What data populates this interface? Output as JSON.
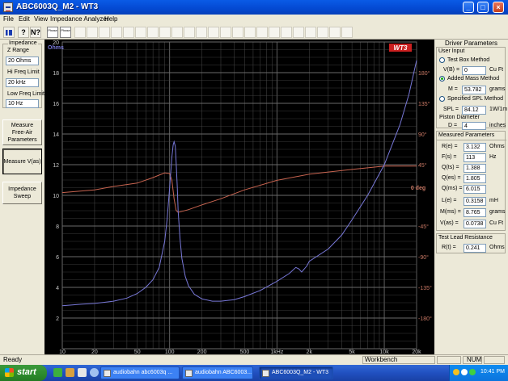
{
  "window": {
    "title": "ABC6003Q_M2 - WT3"
  },
  "titlebar_buttons": {
    "minimize": "_",
    "maximize": "□",
    "close": "×"
  },
  "menu": [
    "File",
    "Edit",
    "View",
    "Impedance Analyzer",
    "Help"
  ],
  "toolbar": {
    "tool1_icon": "chart-icon",
    "tool2_glyph": "?",
    "tool3_glyph": "N?",
    "tool4_label": "Phase",
    "tool5_label": "Phase"
  },
  "sidebar": {
    "impedance_label": "Impedance",
    "z_range_label": "Z Range",
    "z_range_value": "20 Ohms",
    "hi_freq_label": "Hi Freq Limit",
    "hi_freq_value": "20 kHz",
    "low_freq_label": "Low Freq Limit",
    "low_freq_value": "10 Hz",
    "measure_free_air_line1": "Measure",
    "measure_free_air_line2": "Free-Air",
    "measure_free_air_line3": "Parameters",
    "measure_vas": "Measure V(as)",
    "sweep_line1": "Impedance",
    "sweep_line2": "Sweep"
  },
  "plot": {
    "unit_left": "Ohms",
    "badge": "WT3",
    "phase_zero_label": "0 deg",
    "left_ticks": [
      "20",
      "18",
      "16",
      "14",
      "12",
      "10",
      "8",
      "6",
      "4",
      "2"
    ],
    "right_ticks": [
      "180°",
      "135°",
      "90°",
      "45°",
      "-45°",
      "-90°",
      "-135°",
      "-180°"
    ],
    "x_ticks": [
      "10",
      "20",
      "50",
      "100",
      "200",
      "500",
      "1kHz",
      "2k",
      "5k",
      "10k",
      "20k"
    ],
    "colors": {
      "background": "#000000",
      "grid": "#4a4a4a",
      "impedance": "#7878d8",
      "phase": "#c86450",
      "left_axis_text": "#c8c8c8",
      "right_axis_text": "#c87864",
      "badge": "#cc2020"
    }
  },
  "chart_data": {
    "type": "line",
    "xlabel": "",
    "ylabel": "Ohms",
    "xscale": "log",
    "xlim": [
      10,
      20000
    ],
    "ylim": [
      0,
      20
    ],
    "y2lim": [
      -225,
      225
    ],
    "x_ticks": [
      "10",
      "20",
      "50",
      "100",
      "200",
      "500",
      "1kHz",
      "2k",
      "5k",
      "10k",
      "20k"
    ],
    "series": [
      {
        "axis": "left",
        "x": [
          10,
          15,
          20,
          30,
          40,
          50,
          60,
          70,
          80,
          90,
          95,
          100,
          105,
          108,
          110,
          113,
          115,
          118,
          120,
          125,
          130,
          140,
          150,
          170,
          200,
          250,
          300,
          400,
          500,
          700,
          1000,
          1300,
          1500,
          1600,
          1700,
          1900,
          2000,
          3000,
          4000,
          5000,
          7000,
          10000,
          14000,
          17000,
          20000
        ],
        "y": [
          2.8,
          2.9,
          2.95,
          3.1,
          3.3,
          3.6,
          4.0,
          4.5,
          5.3,
          7.0,
          8.5,
          10.5,
          12.5,
          13.3,
          13.5,
          13.2,
          12.2,
          10.5,
          9.0,
          7.2,
          5.9,
          4.7,
          4.1,
          3.55,
          3.25,
          3.1,
          3.1,
          3.2,
          3.4,
          3.8,
          4.4,
          4.9,
          5.3,
          5.2,
          5.0,
          5.4,
          5.7,
          6.5,
          7.4,
          8.4,
          10.0,
          12.0,
          14.6,
          16.6,
          18.8
        ]
      },
      {
        "axis": "right",
        "x": [
          10,
          20,
          30,
          50,
          70,
          90,
          100,
          105,
          110,
          115,
          120,
          150,
          200,
          300,
          500,
          1000,
          2000,
          5000,
          10000,
          20000
        ],
        "y": [
          4,
          8,
          13,
          18,
          26,
          33,
          32,
          22,
          -5,
          -22,
          -25,
          -21,
          -14,
          -5,
          8,
          22,
          31,
          38,
          43,
          43
        ]
      }
    ]
  },
  "params": {
    "title": "Driver Parameters",
    "user_input": "User Input",
    "test_box": "Test Box Method",
    "vb_label": "V(B) =",
    "vb_value": "0",
    "vb_unit": "Cu Ft",
    "added_mass": "Added Mass Method",
    "m_label": "M =",
    "m_value": "53.782",
    "m_unit": "grams",
    "specified_spl": "Specified SPL Method",
    "spl_label": "SPL =",
    "spl_value": "84.12",
    "spl_unit": "1W/1m",
    "piston_label": "Piston Diameter",
    "d_label": "D =",
    "d_value": "4",
    "d_unit": "inches",
    "measured_title": "Measured Parameters",
    "rows": [
      {
        "label": "R(e) =",
        "value": "3.132",
        "unit": "Ohms"
      },
      {
        "label": "F(s) =",
        "value": "113",
        "unit": "Hz"
      },
      {
        "label": "Q(ts) =",
        "value": "1.388",
        "unit": ""
      },
      {
        "label": "Q(es) =",
        "value": "1.805",
        "unit": ""
      },
      {
        "label": "Q(ms) =",
        "value": "6.015",
        "unit": ""
      },
      {
        "label": "L(e) =",
        "value": "0.3158",
        "unit": "mH"
      },
      {
        "label": "M(ms) =",
        "value": "8.765",
        "unit": "grams"
      },
      {
        "label": "V(as) =",
        "value": "0.0738",
        "unit": "Cu Ft"
      }
    ],
    "lead_title": "Test Lead Resistance",
    "rt_label": "R(t) =",
    "rt_value": "0.241",
    "rt_unit": "Ohms"
  },
  "status": {
    "left": "Ready",
    "workbench": "Workbench",
    "num": "NUM"
  },
  "taskbar": {
    "start": "start",
    "tasks": [
      "audiobahn abc6003q ...",
      "audiobahn ABC6003...",
      "ABC6003Q_M2 - WT3"
    ],
    "clock": "10:41 PM"
  }
}
